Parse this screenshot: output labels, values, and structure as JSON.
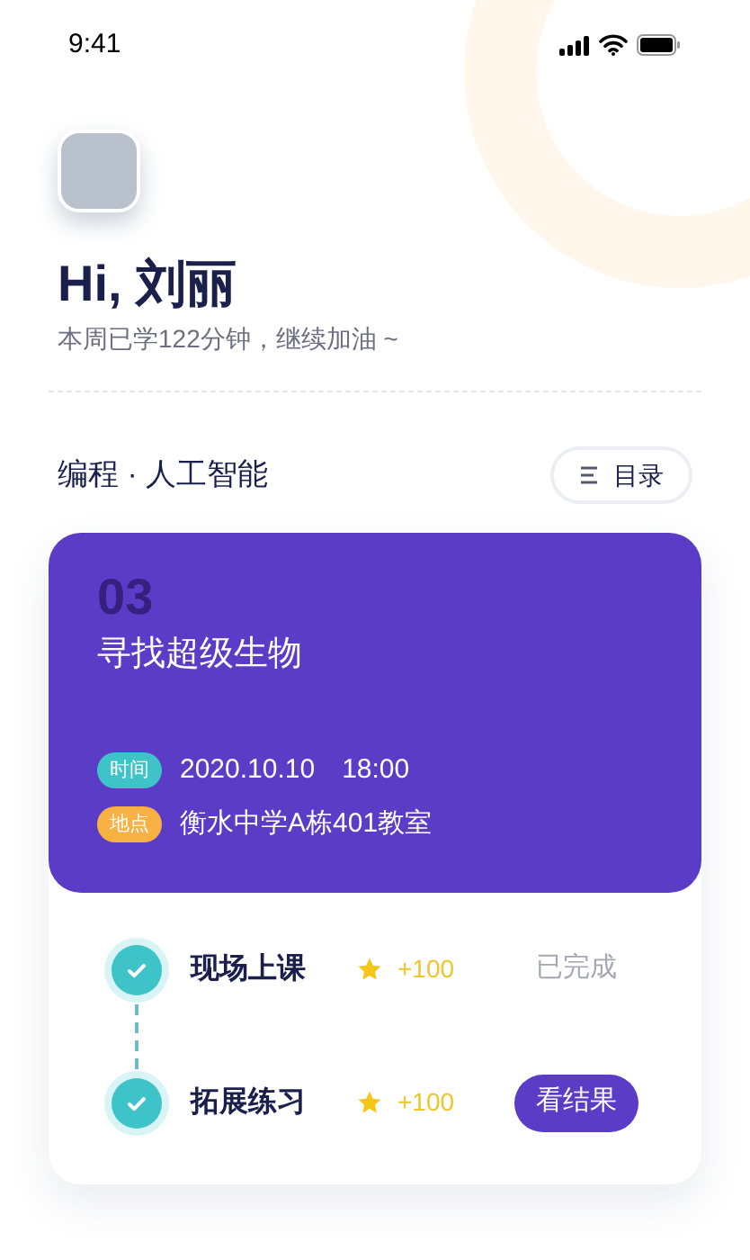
{
  "status_bar": {
    "time": "9:41"
  },
  "greeting": {
    "title": "Hi, 刘丽",
    "subtitle": "本周已学122分钟，继续加油 ~"
  },
  "course": {
    "title": "编程 · 人工智能",
    "catalog_button": "目录"
  },
  "lesson": {
    "number": "03",
    "title": "寻找超级生物",
    "details": [
      {
        "tag": "时间",
        "color": "#3ec3c9",
        "value": "2020.10.10　18:00"
      },
      {
        "tag": "地点",
        "color": "#f7b243",
        "value": "衡水中学A栋401教室"
      }
    ]
  },
  "tasks": [
    {
      "name": "现场上课",
      "checked": true,
      "points": "+100",
      "kind": "status",
      "action": "已完成"
    },
    {
      "name": "拓展练习",
      "checked": true,
      "points": "+100",
      "kind": "button",
      "action": "看结果"
    }
  ]
}
